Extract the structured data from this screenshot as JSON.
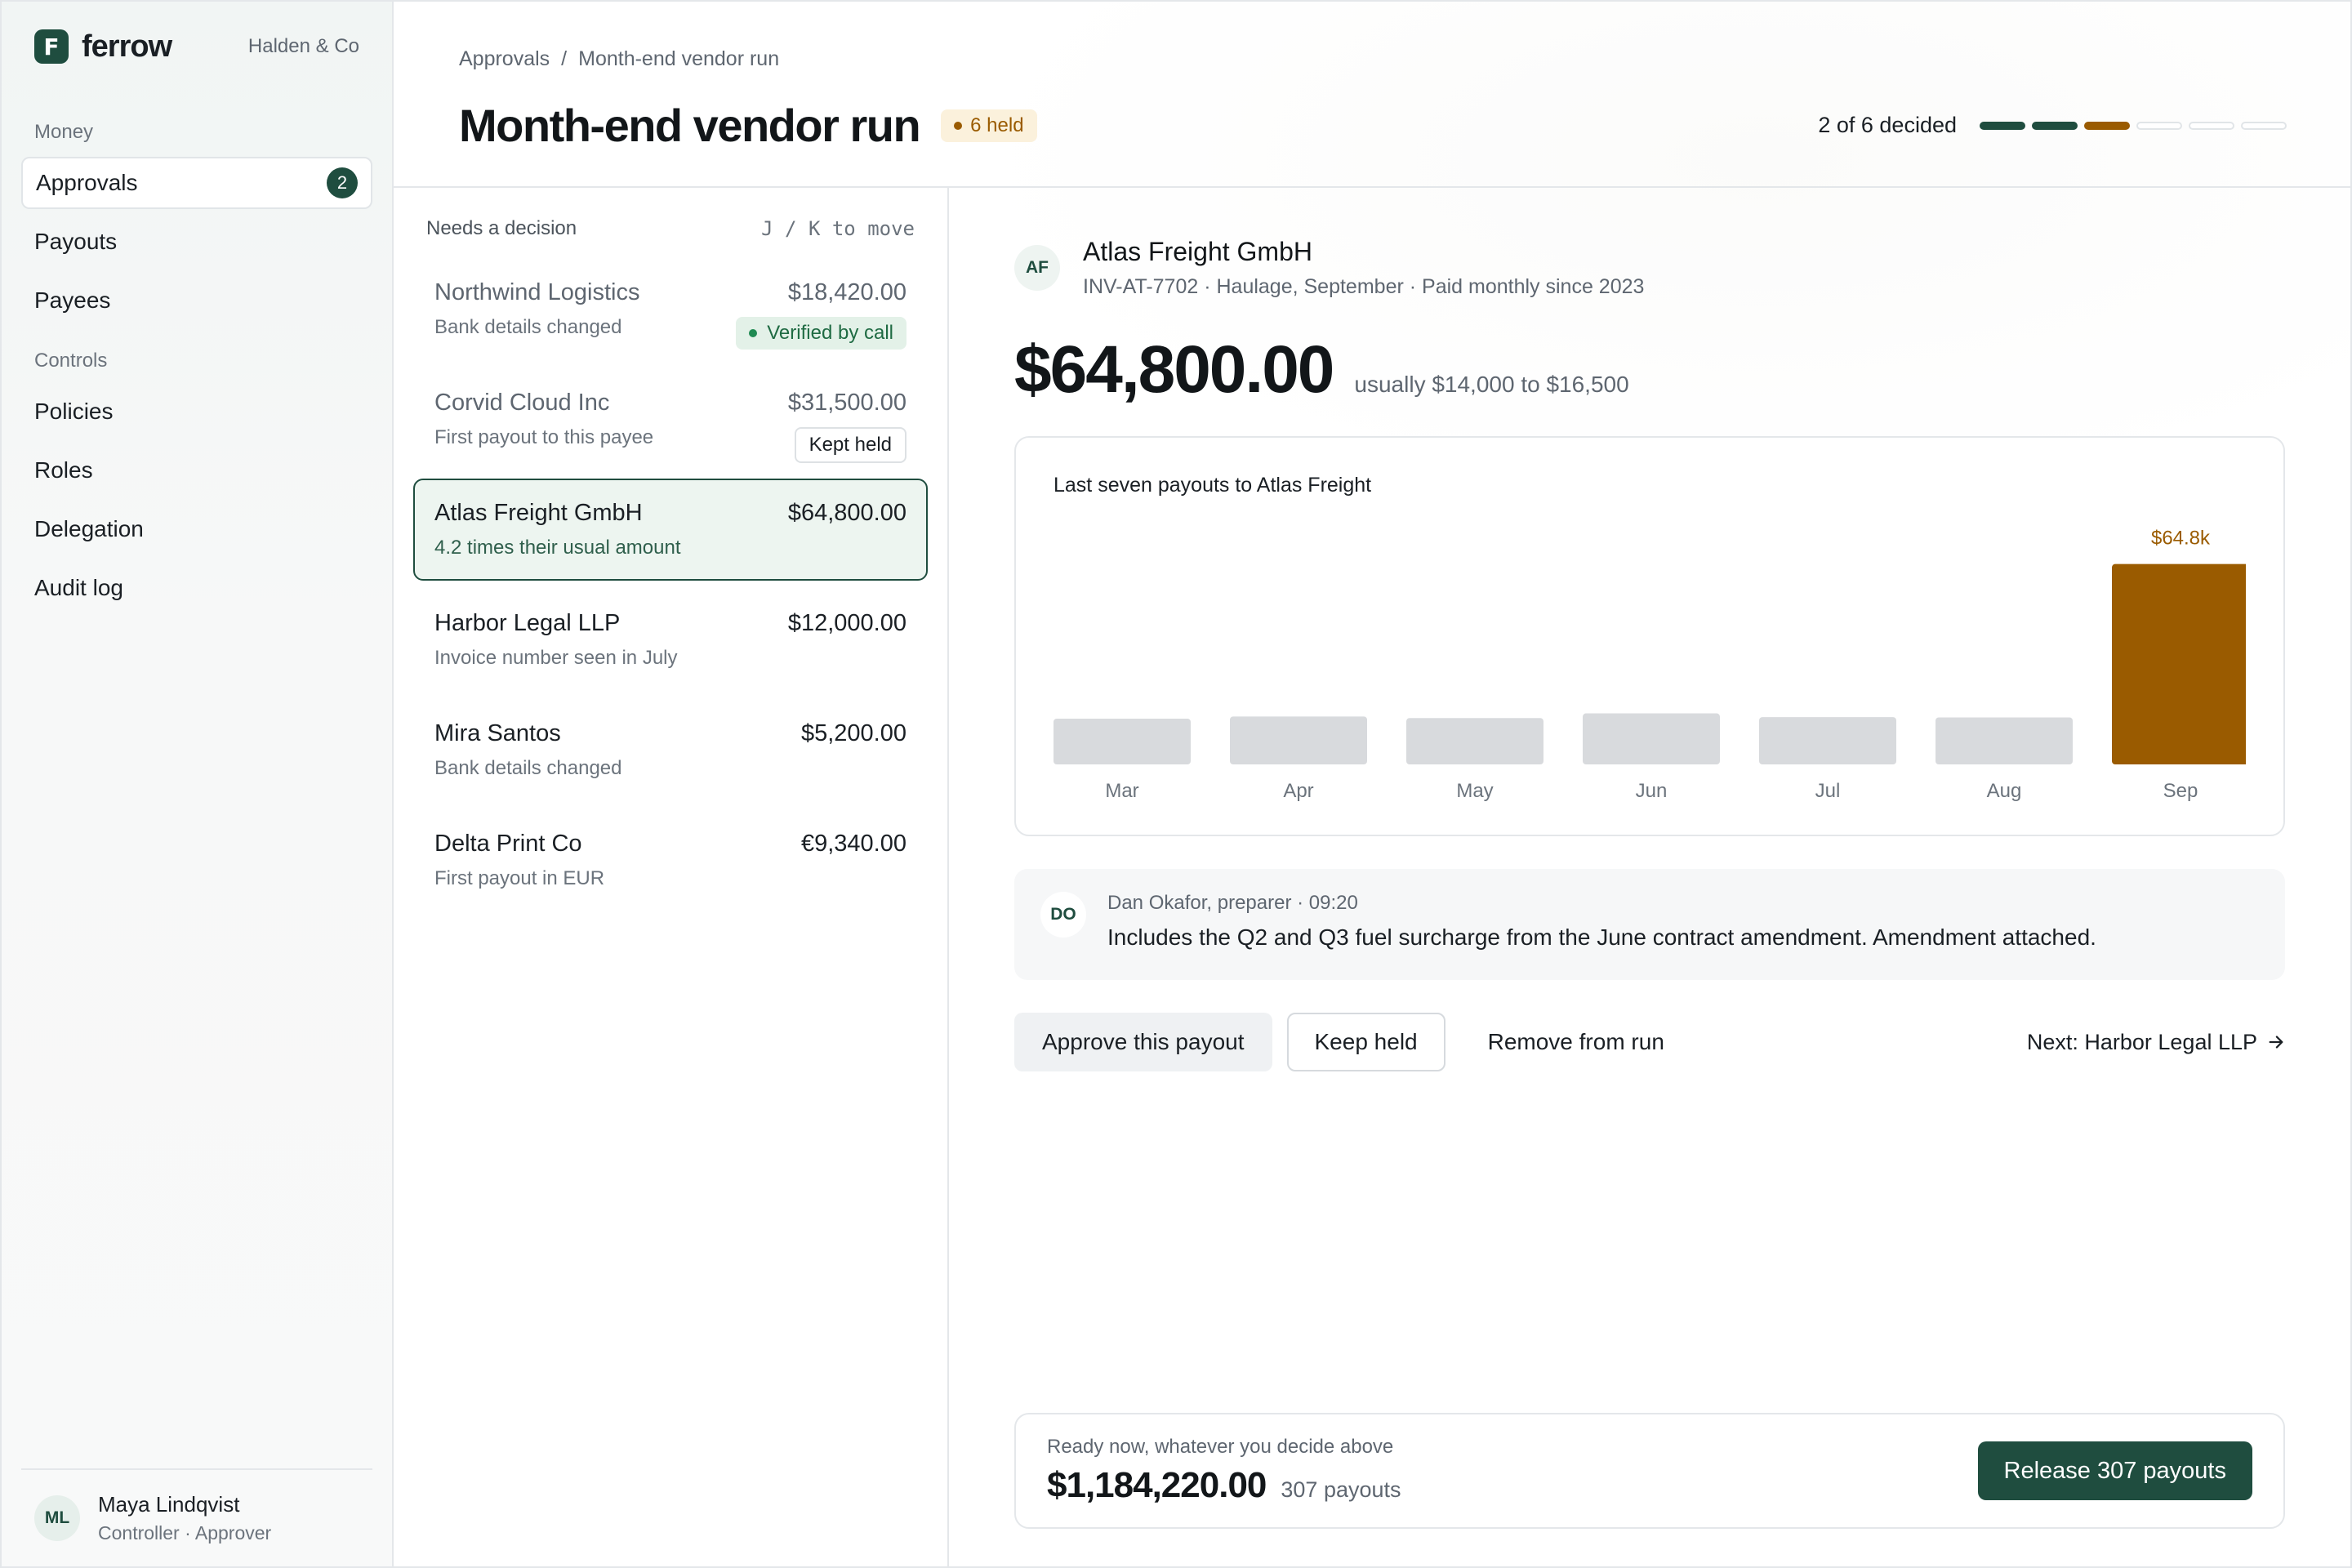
{
  "app": {
    "brand_name": "ferrow",
    "brand_mark": "F",
    "org_name": "Halden & Co",
    "accent_color": "#1f4d3f",
    "warning_color": "#9a5b00"
  },
  "sidebar": {
    "sections": [
      {
        "label": "Money"
      },
      {
        "label": "Controls"
      }
    ],
    "items": [
      {
        "label": "Approvals",
        "count": "2",
        "active": true
      },
      {
        "label": "Payouts"
      },
      {
        "label": "Payees"
      },
      {
        "label": "Policies"
      },
      {
        "label": "Roles"
      },
      {
        "label": "Delegation"
      },
      {
        "label": "Audit log"
      }
    ],
    "user": {
      "initials": "ML",
      "name": "Maya Lindqvist",
      "role": "Controller · Approver"
    }
  },
  "header": {
    "breadcrumb": [
      "Approvals",
      "/",
      "Month-end vendor run"
    ],
    "title": "Month-end vendor run",
    "held_badge": "6 held",
    "progress_label": "2 of 6 decided",
    "progress": {
      "decided": 2,
      "total": 6,
      "segments": [
        "done",
        "done",
        "flag",
        "empty",
        "empty",
        "empty"
      ]
    }
  },
  "queue": {
    "title": "Needs a decision",
    "hint": "J / K to move",
    "items": [
      {
        "name": "Northwind Logistics",
        "amount": "$18,420.00",
        "reason": "Bank details changed",
        "tag": "Verified by call",
        "state": "verified"
      },
      {
        "name": "Corvid Cloud Inc",
        "amount": "$31,500.00",
        "reason": "First payout to this payee",
        "tag": "Kept held",
        "state": "kept"
      },
      {
        "name": "Atlas Freight GmbH",
        "amount": "$64,800.00",
        "reason": "4.2 times their usual amount",
        "state": "selected"
      },
      {
        "name": "Harbor Legal LLP",
        "amount": "$12,000.00",
        "reason": "Invoice number seen in July"
      },
      {
        "name": "Mira Santos",
        "amount": "$5,200.00",
        "reason": "Bank details changed"
      },
      {
        "name": "Delta Print Co",
        "amount": "€9,340.00",
        "reason": "First payout in EUR"
      }
    ]
  },
  "detail": {
    "initials": "AF",
    "payee_name": "Atlas Freight GmbH",
    "meta": "INV-AT-7702 · Haulage, September · Paid monthly since 2023",
    "amount": "$64,800.00",
    "usual": "usually $14,000 to $16,500",
    "chart_title": "Last seven payouts to Atlas Freight",
    "note": {
      "initials": "DO",
      "author": "Dan Okafor, preparer · 09:20",
      "body": "Includes the Q2 and Q3 fuel surcharge from the June contract amendment. Amendment attached."
    },
    "actions": {
      "approve": "Approve this payout",
      "keep": "Keep held",
      "remove": "Remove from run",
      "next": "Next: Harbor Legal LLP",
      "next_icon": "arrow-right-icon"
    }
  },
  "chart_data": {
    "type": "bar",
    "title": "Last seven payouts to Atlas Freight",
    "categories": [
      "Mar",
      "Apr",
      "May",
      "Jun",
      "Jul",
      "Aug",
      "Sep"
    ],
    "values": [
      14800,
      15500,
      15000,
      16500,
      15300,
      15200,
      64800
    ],
    "highlight_index": 6,
    "data_labels": [
      "",
      "",
      "",
      "",
      "",
      "",
      "$64.8k"
    ],
    "xlabel": "",
    "ylabel": "",
    "ylim": [
      0,
      70000
    ],
    "grid": false,
    "colors": {
      "default": "#d8dadd",
      "highlight": "#9a5b00"
    }
  },
  "footer": {
    "label": "Ready now, whatever you decide above",
    "amount": "$1,184,220.00",
    "count": "307 payouts",
    "release_label": "Release 307 payouts"
  }
}
